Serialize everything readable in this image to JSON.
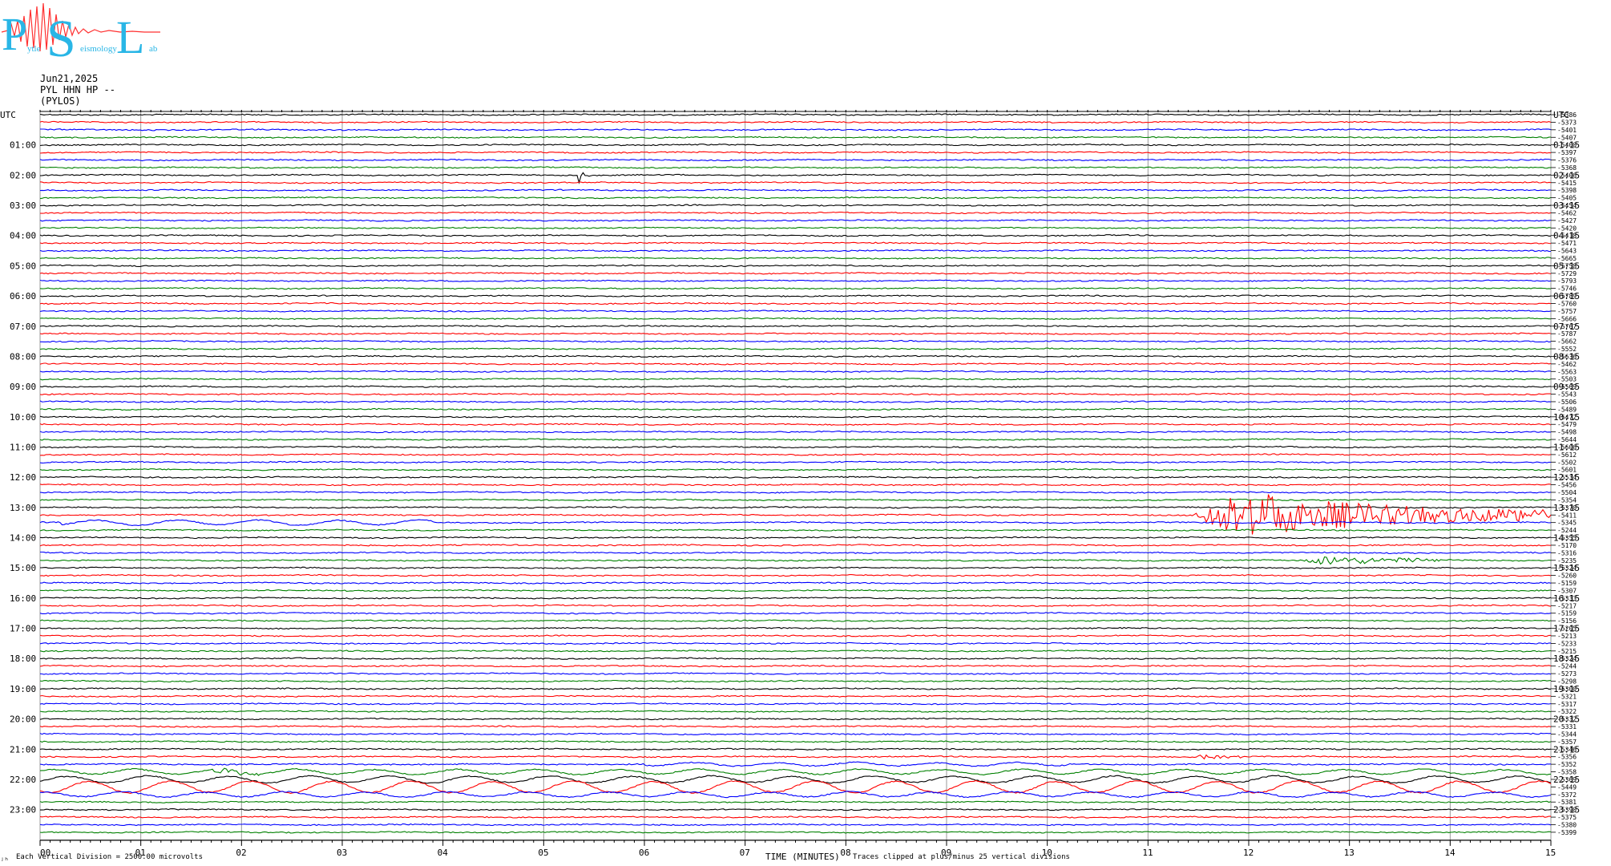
{
  "logo": {
    "big_letters": [
      "P",
      "S",
      "L"
    ],
    "small_text": [
      "ytle",
      "eismology",
      "ab"
    ]
  },
  "header": {
    "date": "Jun21,2025",
    "station": "PYL HHN HP --",
    "location": "(PYLOS)"
  },
  "axis": {
    "utc_left": "UTC",
    "utc_right": "UTC",
    "left_hours": [
      "01:00",
      "02:00",
      "03:00",
      "04:00",
      "05:00",
      "06:00",
      "07:00",
      "08:00",
      "09:00",
      "10:00",
      "11:00",
      "12:00",
      "13:00",
      "14:00",
      "15:00",
      "16:00",
      "17:00",
      "18:00",
      "19:00",
      "20:00",
      "21:00",
      "22:00",
      "23:00"
    ],
    "right_hours": [
      "01:15",
      "02:15",
      "03:15",
      "04:15",
      "05:15",
      "06:15",
      "07:15",
      "08:15",
      "09:15",
      "10:15",
      "11:15",
      "12:15",
      "13:15",
      "14:15",
      "15:15",
      "16:15",
      "17:15",
      "18:15",
      "19:15",
      "20:15",
      "21:15",
      "22:15",
      "23:15"
    ],
    "x_ticks": [
      "00",
      "01",
      "02",
      "03",
      "04",
      "05",
      "06",
      "07",
      "08",
      "09",
      "10",
      "11",
      "12",
      "13",
      "14",
      "15"
    ],
    "x_label": "TIME (MINUTES)"
  },
  "footer": {
    "left_mark": "ⱼₕ",
    "scale_note": "Each Vertical Division = 2500.00 microvolts",
    "clip_note": "Traces clipped at plus/minus 25 vertical divisions"
  },
  "chart_data": {
    "type": "line",
    "title": "",
    "xlabel": "TIME (MINUTES)",
    "ylabel": "",
    "xlim": [
      0,
      15
    ],
    "trace_minutes": 15,
    "trace_count": 96,
    "trace_colors": [
      "#000000",
      "#ff0000",
      "#0000ff",
      "#008000"
    ],
    "grid": true,
    "right_values": [
      -5386,
      -5373,
      -5401,
      -5407,
      -5400,
      -5397,
      -5376,
      -5368,
      -5406,
      -5415,
      -5398,
      -5405,
      -5454,
      -5462,
      -5427,
      -5420,
      -5418,
      -5471,
      -5643,
      -5665,
      -5758,
      -5729,
      -5793,
      -5746,
      -5789,
      -5760,
      -5757,
      -5666,
      -5767,
      -5787,
      -5662,
      -5552,
      -5636,
      -5462,
      -5563,
      -5503,
      -5569,
      -5543,
      -5506,
      -5489,
      -5472,
      -5479,
      -5498,
      -5644,
      -5606,
      -5612,
      -5502,
      -5601,
      -5534,
      -5456,
      -5504,
      -5354,
      -5370,
      -5411,
      -5345,
      -5244,
      -5355,
      -5170,
      -5316,
      -5235,
      -5324,
      -5260,
      -5159,
      -5307,
      -5333,
      -5217,
      -5159,
      -5156,
      -5205,
      -5213,
      -5233,
      -5215,
      -5324,
      -5244,
      -5273,
      -5298,
      -5300,
      -5321,
      -5317,
      -5322,
      -5332,
      -5331,
      -5344,
      -5357,
      -5346,
      -5356,
      -5352,
      -5358,
      -5369,
      -5449,
      -5372,
      -5381,
      -5390,
      -5375,
      -5380,
      -5399
    ],
    "events": [
      {
        "trace": 8,
        "minute": 5.35,
        "amplitude": 34,
        "duration_minutes": 0.15,
        "shape": "spike"
      },
      {
        "trace": 53,
        "minute": 11.45,
        "amplitude": 38,
        "duration_minutes": 3.55,
        "shape": "quake"
      },
      {
        "trace": 59,
        "minute": 12.55,
        "amplitude": 8,
        "duration_minutes": 1.6,
        "shape": "quake"
      },
      {
        "trace": 85,
        "minute": 11.45,
        "amplitude": 4,
        "duration_minutes": 0.6,
        "shape": "quake"
      },
      {
        "trace": 87,
        "minute": 1.7,
        "amplitude": 7,
        "duration_minutes": 0.5,
        "shape": "quake"
      }
    ],
    "long_period": [
      {
        "trace": 54,
        "from_minute": 0.2,
        "to_minute": 3.9,
        "amplitude": 3
      },
      {
        "trace": 86,
        "from_minute": 6.0,
        "to_minute": 10.2,
        "amplitude": 2
      },
      {
        "trace": 87,
        "from_minute": 0,
        "to_minute": 15,
        "amplitude": 3
      },
      {
        "trace": 88,
        "from_minute": 0,
        "to_minute": 15,
        "amplitude": 4
      },
      {
        "trace": 89,
        "from_minute": 0,
        "to_minute": 15,
        "amplitude": 7
      },
      {
        "trace": 90,
        "from_minute": 0,
        "to_minute": 15,
        "amplitude": 3
      }
    ]
  }
}
